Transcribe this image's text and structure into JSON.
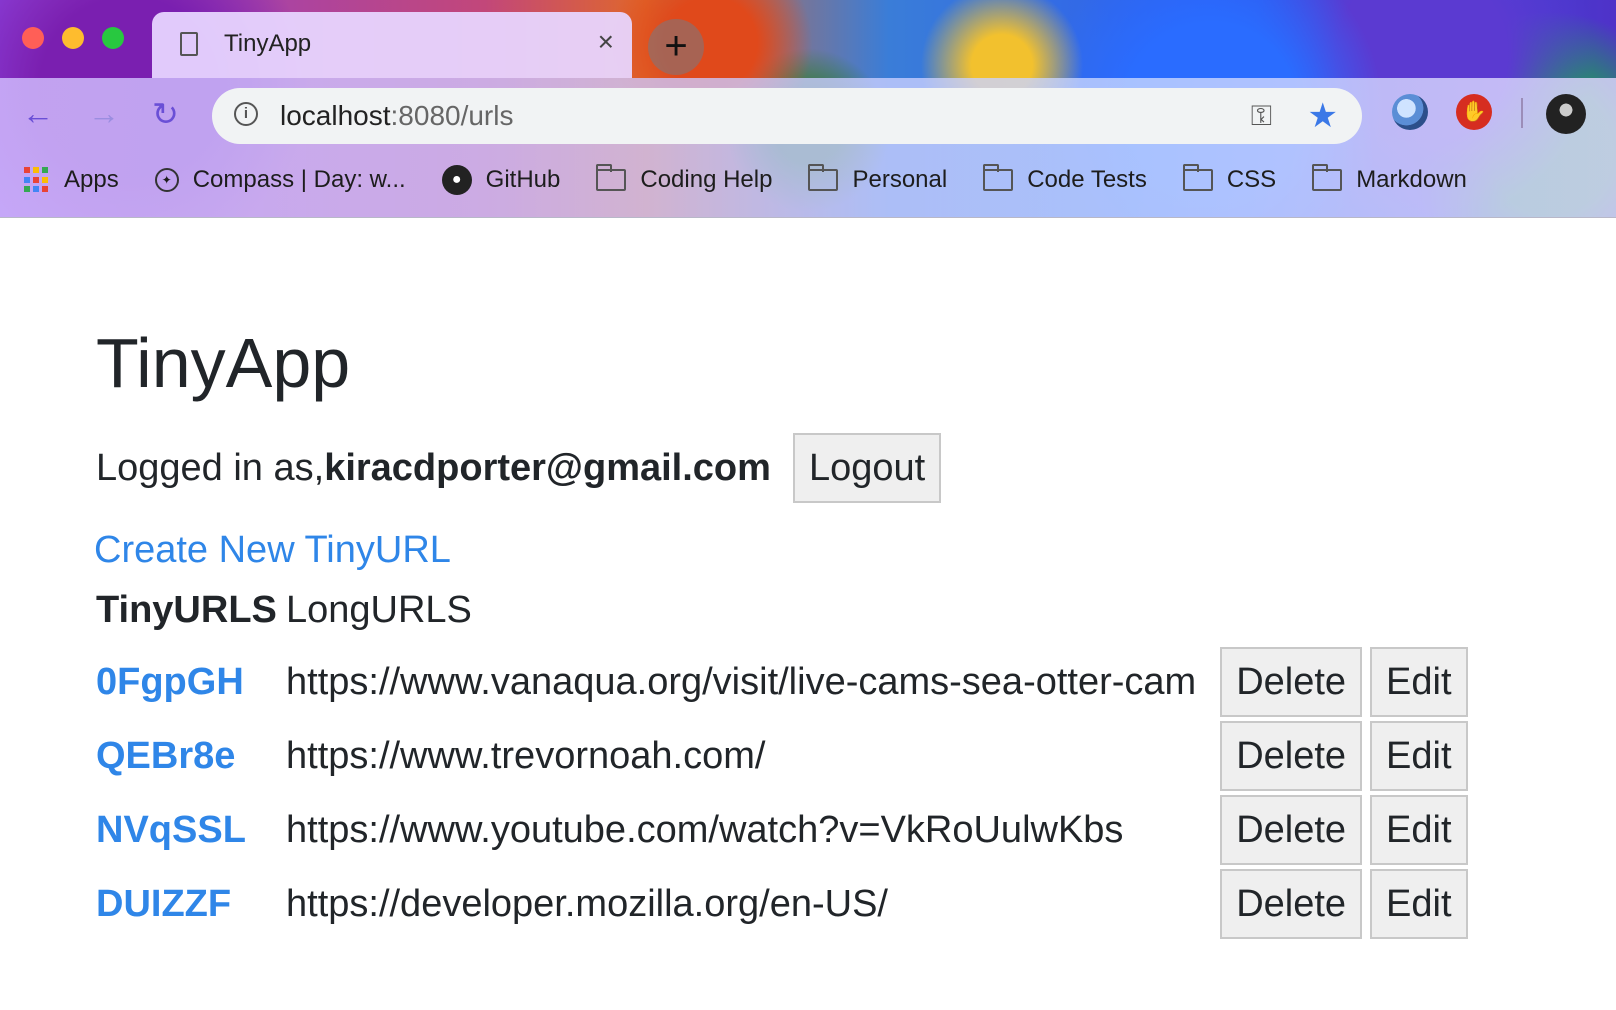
{
  "browser": {
    "tab_title": "TinyApp",
    "tab_close": "×",
    "new_tab": "+",
    "url_host": "localhost",
    "url_path": ":8080/urls",
    "bookmarks": [
      {
        "label": "Apps",
        "icon": "apps-grid-icon"
      },
      {
        "label": "Compass | Day: w...",
        "icon": "compass-icon"
      },
      {
        "label": "GitHub",
        "icon": "github-icon"
      },
      {
        "label": "Coding Help",
        "icon": "folder-icon"
      },
      {
        "label": "Personal",
        "icon": "folder-icon"
      },
      {
        "label": "Code Tests",
        "icon": "folder-icon"
      },
      {
        "label": "CSS",
        "icon": "folder-icon"
      },
      {
        "label": "Markdown",
        "icon": "folder-icon"
      }
    ],
    "colors": {
      "star": "#3b78e7",
      "adblock": "#d62d20"
    }
  },
  "page": {
    "title": "TinyApp",
    "logged_in_label": "Logged in as,",
    "user_email": "kiracdporter@gmail.com",
    "logout_label": "Logout",
    "create_link": "Create New TinyURL",
    "link_color": "#2f86e8",
    "table": {
      "headers": {
        "tiny": "TinyURLS",
        "long": "LongURLS"
      },
      "rows": [
        {
          "short": "0FgpGH",
          "long": "https://www.vanaqua.org/visit/live-cams-sea-otter-cam"
        },
        {
          "short": "QEBr8e",
          "long": "https://www.trevornoah.com/"
        },
        {
          "short": "NVqSSL",
          "long": "https://www.youtube.com/watch?v=VkRoUulwKbs"
        },
        {
          "short": "DUIZZF",
          "long": "https://developer.mozilla.org/en-US/"
        }
      ],
      "delete_label": "Delete",
      "edit_label": "Edit"
    }
  }
}
